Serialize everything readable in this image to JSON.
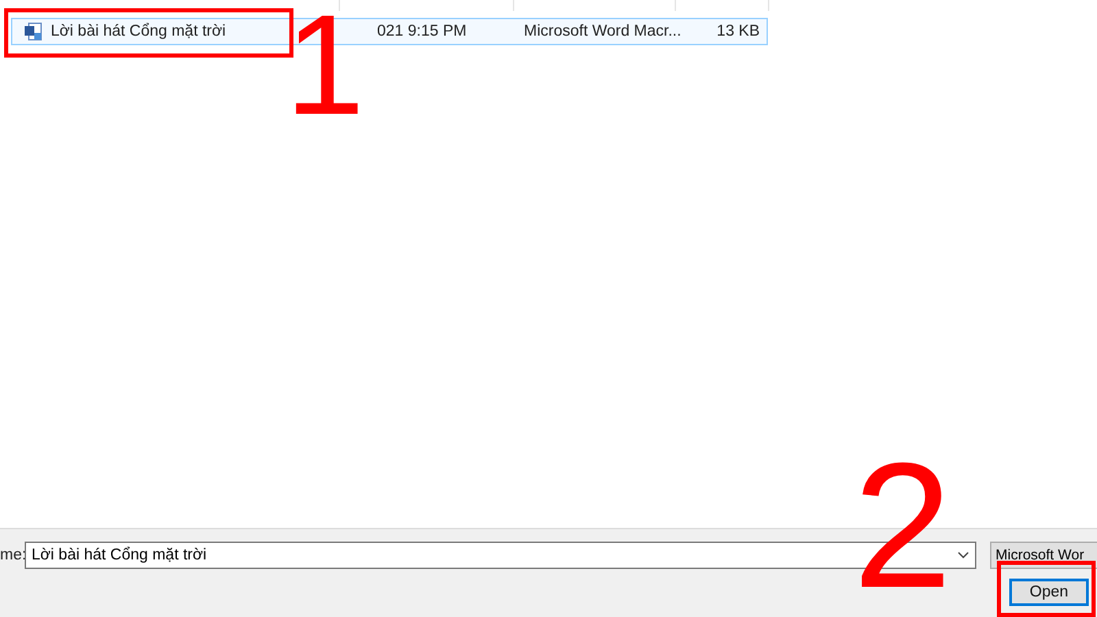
{
  "file_list": {
    "rows": [
      {
        "name": "Lời bài hát Cổng mặt trời",
        "date_modified": "021 9:15 PM",
        "type": "Microsoft Word Macr...",
        "size": "13 KB",
        "selected": true
      }
    ]
  },
  "footer": {
    "file_name_label": "me:",
    "file_name_value": "Lời bài hát Cổng mặt trời",
    "file_type_filter": "Microsoft Wor",
    "open_button": "Open"
  },
  "annotations": [
    {
      "label": "1"
    },
    {
      "label": "2"
    }
  ]
}
